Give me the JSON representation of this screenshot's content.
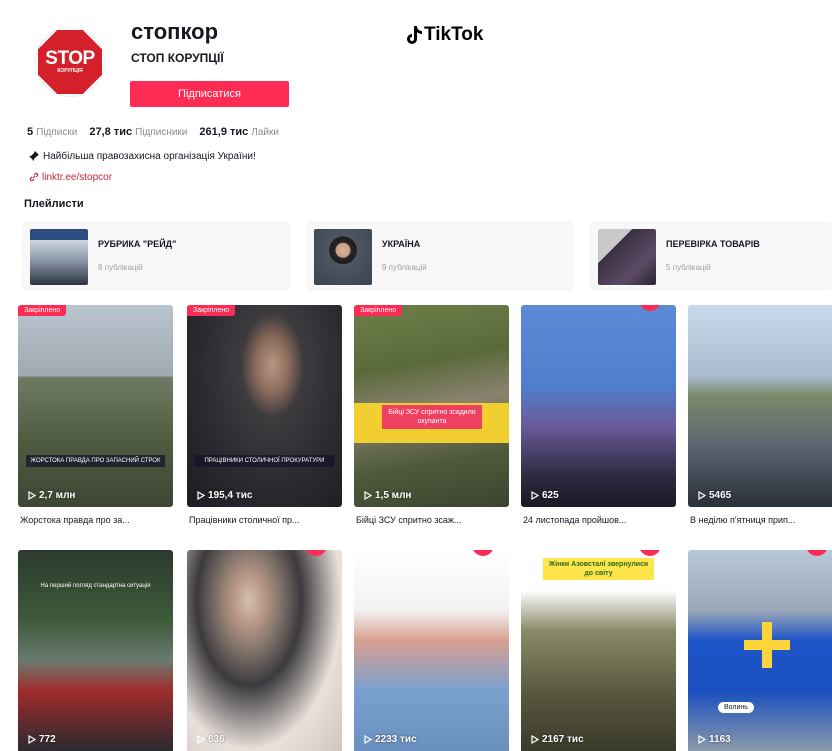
{
  "profile": {
    "username": "стопкор",
    "nickname": "СТОП КОРУПЦІЇ",
    "avatar_text_big": "STOP",
    "avatar_text_small": "КОРУПЦІЯ",
    "follow_label": "Підписатися",
    "brand": "TikTok",
    "stats": [
      {
        "value": "5",
        "label": "Підписки"
      },
      {
        "value": "27,8 тис",
        "label": "Підписники"
      },
      {
        "value": "261,9 тис",
        "label": "Лайки"
      }
    ],
    "bio": "Найбільша правозахисна організація України!",
    "bio_icon": "pushpin-icon",
    "link": "linktr.ee/stopcor",
    "link_icon": "link-icon"
  },
  "playlists": {
    "title": "Плейлисти",
    "items": [
      {
        "title": "РУБРИКА \"РЕЙД\"",
        "count": "8 публікацій"
      },
      {
        "title": "УКРАЇНА",
        "count": "9 публікацій"
      },
      {
        "title": "ПЕРЕВІРКА ТОВАРІВ",
        "count": "5 публікацій"
      }
    ]
  },
  "videos": [
    {
      "pin": "Закріплено",
      "views": "2,7 млн",
      "caption": "Жорстока правда про за...",
      "overlay": "ЖОРСТОКА ПРАВДА ПРО ЗАПАСНИЙ СТРОК"
    },
    {
      "pin": "Закріплено",
      "views": "195,4 тис",
      "caption": "Працівники столичної пр...",
      "overlay": "ПРАЦІВНИКИ СТОЛИЧНОЇ ПРОКУРАТУРИ"
    },
    {
      "pin": "Закріплено",
      "views": "1,5 млн",
      "caption": "Бійці ЗСУ спритно зсаж...",
      "overlay": "Бійці ЗСУ спритно зсадили окупанта"
    },
    {
      "pin": "",
      "views": "625",
      "caption": "24 листопада пройшов...",
      "overlay": ""
    },
    {
      "pin": "",
      "views": "5465",
      "caption": "В неділю п'ятниця прип...",
      "overlay": ""
    },
    {
      "pin": "",
      "views": "772",
      "caption": "",
      "overlay": "На перший погляд стандартна ситуація"
    },
    {
      "pin": "",
      "views": "636",
      "caption": "",
      "overlay": ""
    },
    {
      "pin": "",
      "views": "2233 тис",
      "caption": "",
      "overlay": ""
    },
    {
      "pin": "",
      "views": "2167 тис",
      "caption": "",
      "overlay": "Жінки Азовсталі звернулися до світу"
    },
    {
      "pin": "",
      "views": "1163",
      "caption": "",
      "overlay": "Волинь"
    }
  ],
  "icons": {
    "play": "play-icon",
    "tiktok": "tiktok-note-icon"
  },
  "colors": {
    "accent": "#fe2c55",
    "stop_red": "#d4202a",
    "text": "#161823",
    "muted": "#8a8b91"
  }
}
